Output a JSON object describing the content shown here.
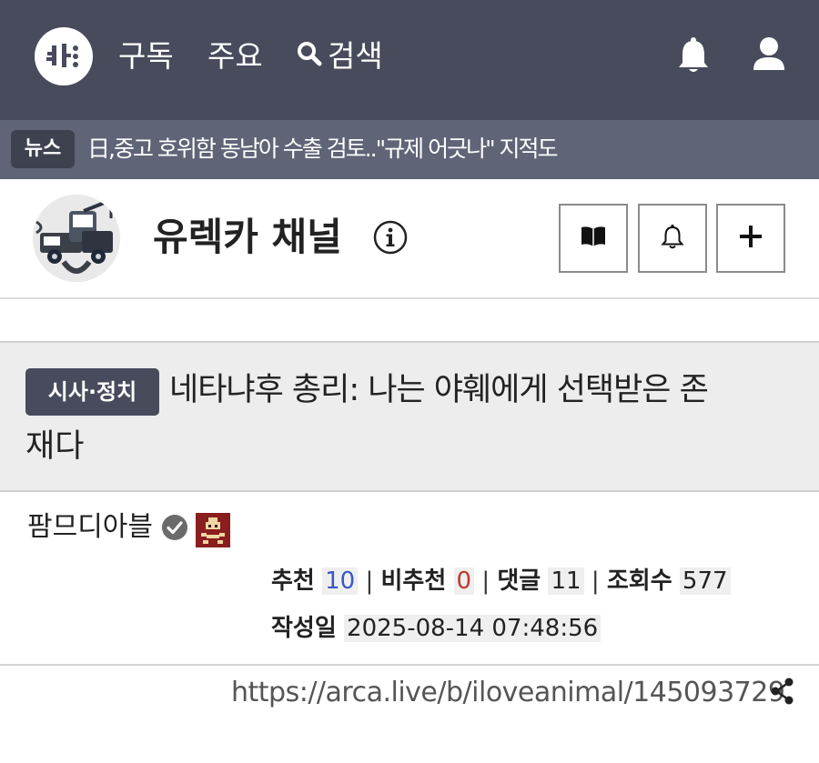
{
  "nav": {
    "subscribe": "구독",
    "main": "주요",
    "search": "검색"
  },
  "news": {
    "badge": "뉴스",
    "headline": "日,중고 호위함 동남아 수출 검토..\"규제 어긋나\" 지적도"
  },
  "channel": {
    "title": "유렉카 채널"
  },
  "article": {
    "category": "시사·정치",
    "title_line1": "네타냐후 총리: 나는 야훼에게 선택받은 존",
    "title_line2": "재다",
    "author": "팜므디아블",
    "stats": {
      "upvote_label": "추천",
      "upvote_value": "10",
      "downvote_label": "비추천",
      "downvote_value": "0",
      "comments_label": "댓글",
      "comments_value": "11",
      "views_label": "조회수",
      "views_value": "577"
    },
    "date_label": "작성일",
    "date_value": "2025-08-14 07:48:56",
    "url": "https://arca.live/b/iloveanimal/145093729"
  },
  "colors": {
    "nav_bg": "#474b5c",
    "news_bg": "#5f6477",
    "upvote": "#3a57c4",
    "downvote": "#c0392b",
    "article_head_bg": "#ededed"
  },
  "icons": [
    "site-logo-icon",
    "search-icon",
    "bell-icon",
    "user-icon",
    "info-icon",
    "book-icon",
    "bell-outline-icon",
    "plus-icon",
    "verified-check-icon",
    "share-icon"
  ]
}
